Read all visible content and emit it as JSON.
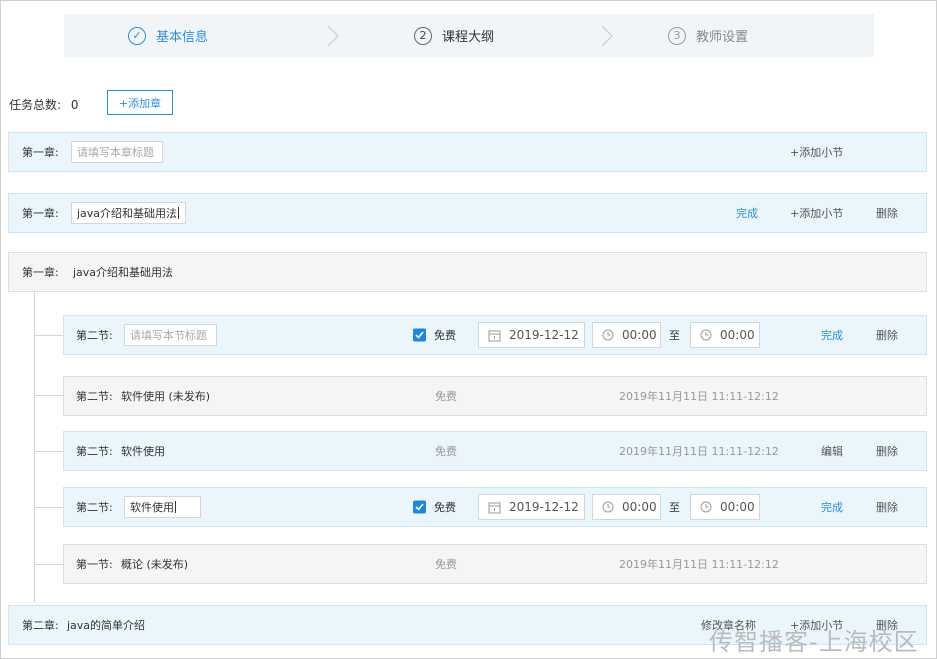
{
  "steps": [
    {
      "num": "✓",
      "label": "基本信息",
      "state": "done"
    },
    {
      "num": "2",
      "label": "课程大纲",
      "state": "active"
    },
    {
      "num": "3",
      "label": "教师设置",
      "state": "todo"
    }
  ],
  "task": {
    "label": "任务总数:",
    "count": "0",
    "add_chapter": "+添加章"
  },
  "chapter_rows": [
    {
      "label": "第一章:",
      "placeholder": "请填写本章标题",
      "add_section": "+添加小节"
    },
    {
      "label": "第一章:",
      "value": "java介绍和基础用法",
      "done": "完成",
      "add_section": "+添加小节",
      "delete": "删除"
    },
    {
      "label": "第一章:",
      "title": "java介绍和基础用法"
    }
  ],
  "sections": [
    {
      "label": "第二节:",
      "placeholder": "请填写本节标题",
      "free": "免费",
      "date": "2019-12-12",
      "start": "00:00",
      "to": "至",
      "end": "00:00",
      "done": "完成",
      "delete": "删除"
    },
    {
      "label": "第二节:",
      "title": "软件使用 (未发布)",
      "free": "免费",
      "time": "2019年11月11日 11:11-12:12"
    },
    {
      "label": "第二节:",
      "title": "软件使用",
      "free": "免费",
      "time": "2019年11月11日 11:11-12:12",
      "edit": "编辑",
      "delete": "删除"
    },
    {
      "label": "第二节:",
      "value": "软件使用",
      "free": "免费",
      "date": "2019-12-12",
      "start": "00:00",
      "to": "至",
      "end": "00:00",
      "done": "完成",
      "delete": "删除"
    },
    {
      "label": "第一节:",
      "title": "概论 (未发布)",
      "free": "免费",
      "time": "2019年11月11日 11:11-12:12"
    }
  ],
  "chapter2": {
    "label": "第二章:",
    "title": "java的简单介绍",
    "rename": "修改章名称",
    "add_section": "+添加小节",
    "delete": "删除"
  },
  "watermark": "传智播客-上海校区",
  "colors": {
    "accent": "#2e8fd8",
    "row_blue": "#eaf5fc",
    "row_gray": "#f5f5f5"
  }
}
